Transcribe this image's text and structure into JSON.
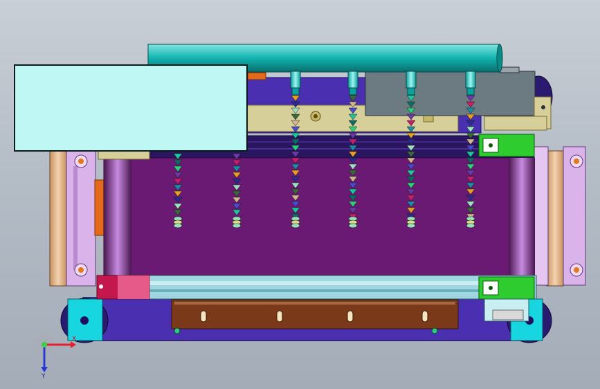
{
  "viewport": {
    "background_top": "#c9cfd6",
    "background_bottom": "#a4acb8"
  },
  "colors": {
    "belt": "#6a1a73",
    "frame": "#4a2fb0",
    "cyan_part": "#12b3b0",
    "cyan_light": "#bff7f4",
    "tan_plate": "#d6cf9a",
    "brown_plate": "#7a3a1a",
    "gray_box": "#6c7a82",
    "green_bracket": "#2ecc2e",
    "side_plate": "#d9b3ea",
    "roller_tan": "#e6b48a",
    "pink_block": "#c4174d"
  },
  "model": {
    "nozzle_count": 6,
    "column_count": 6,
    "bead_colors": [
      "#19c99b",
      "#0c6e63",
      "#2ad17a",
      "#6a3aa8",
      "#c91f6b",
      "#1a8fa3",
      "#e6a020",
      "#2b2b8f",
      "#9be0c0",
      "#3a6a3a",
      "#d2b48c",
      "#4a4ad0"
    ],
    "icons": [
      "coordinate-triad-icon"
    ]
  },
  "triad": {
    "x_label": "X",
    "y_label": "Y"
  }
}
